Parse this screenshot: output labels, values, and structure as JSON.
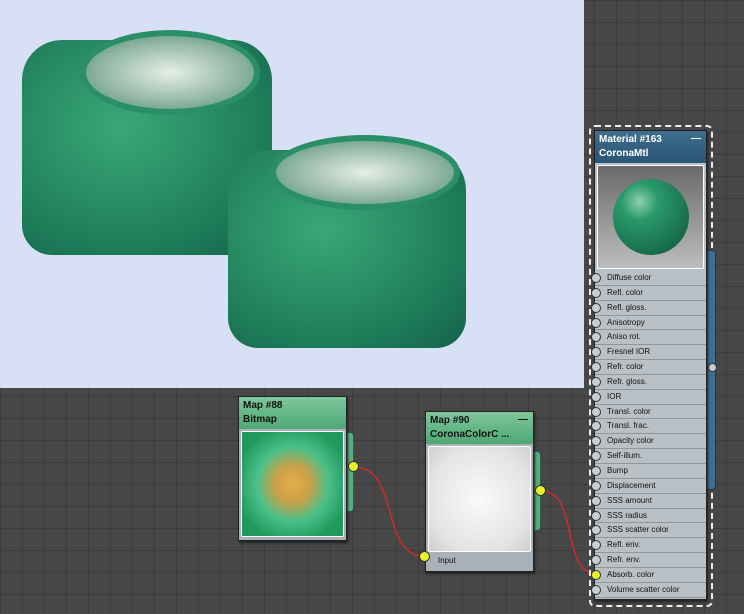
{
  "material_node": {
    "title": "Material #163",
    "type": "CoronaMtl",
    "minimize": "—",
    "slots": [
      "Diffuse color",
      "Refl. color",
      "Refl. gloss.",
      "Anisotropy",
      "Aniso rot.",
      "Fresnel IOR",
      "Refr. color",
      "Refr. gloss.",
      "IOR",
      "Transl. color",
      "Transl. frac.",
      "Opacity color",
      "Self-illum.",
      "Bump",
      "Displacement",
      "SSS amount",
      "SSS radius",
      "SSS scatter color",
      "Refl. env.",
      "Refr. env.",
      "Absorb. color",
      "Volume scatter color"
    ],
    "connected_slot": "Absorb. color"
  },
  "bitmap_node": {
    "title": "Map #88",
    "type": "Bitmap"
  },
  "color_node": {
    "title": "Map #90",
    "type": "CoronaColorC ...",
    "minimize": "—",
    "input_label": "Input"
  },
  "colors": {
    "wire": "#d02a2a",
    "socket_active": "#e6f62a",
    "material_header": "#2e5a78",
    "map_header": "#5fb682"
  }
}
